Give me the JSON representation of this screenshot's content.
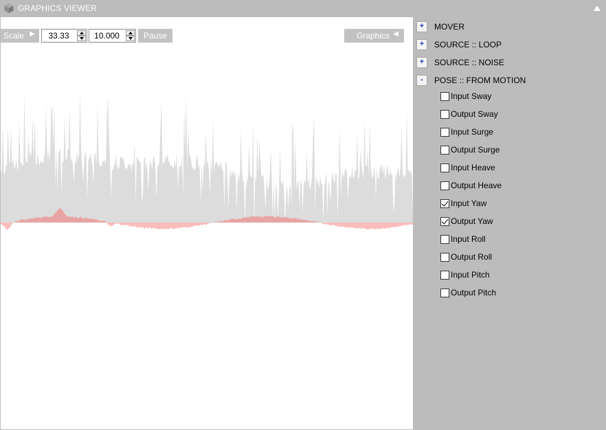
{
  "window": {
    "title": "GRAPHICS VIEWER",
    "app_icon": "hexagon-cube-icon",
    "collapse_icon": "triangle-up-icon"
  },
  "toolbar": {
    "scale_label": "Scale",
    "scale_value": "33.33",
    "second_value": "10.000",
    "pause_label": "Pause",
    "graphics_label": "Graphics"
  },
  "sections": [
    {
      "toggle": "+",
      "label": "MOVER"
    },
    {
      "toggle": "+",
      "label": "SOURCE :: LOOP"
    },
    {
      "toggle": "+",
      "label": "SOURCE :: NOISE"
    },
    {
      "toggle": "-",
      "label": "POSE :: FROM MOTION"
    }
  ],
  "channels": [
    {
      "label": "Input Sway",
      "checked": false
    },
    {
      "label": "Output Sway",
      "checked": false
    },
    {
      "label": "Input Surge",
      "checked": false
    },
    {
      "label": "Output Surge",
      "checked": false
    },
    {
      "label": "Input Heave",
      "checked": false
    },
    {
      "label": "Output Heave",
      "checked": false
    },
    {
      "label": "Input Yaw",
      "checked": true
    },
    {
      "label": "Output Yaw",
      "checked": true
    },
    {
      "label": "Input Roll",
      "checked": false
    },
    {
      "label": "Output Roll",
      "checked": false
    },
    {
      "label": "Input Pitch",
      "checked": false
    },
    {
      "label": "Output Pitch",
      "checked": false
    }
  ],
  "graph": {
    "colors": {
      "input_trace": "#dcdcdc",
      "output_positive": "#e8a4a4",
      "output_negative": "#fbbcbc",
      "background": "#ffffff"
    }
  }
}
